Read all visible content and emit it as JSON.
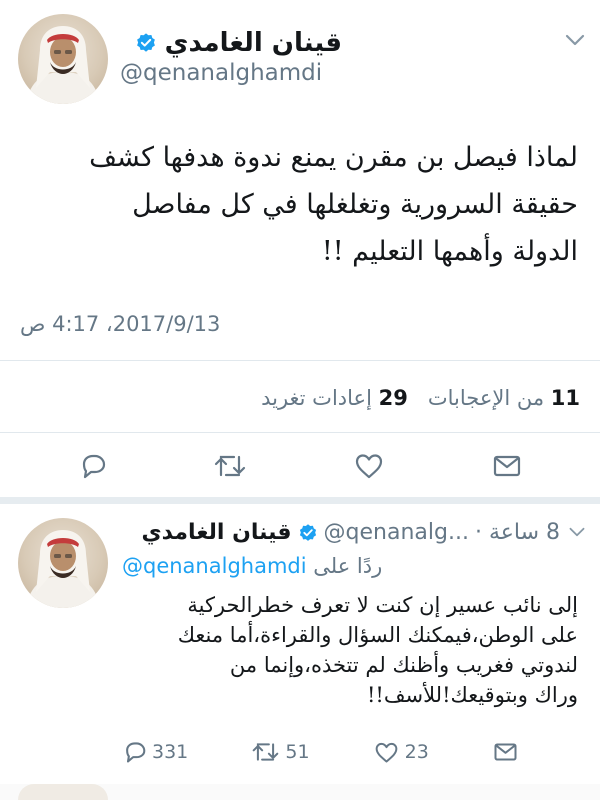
{
  "main_tweet": {
    "display_name": "قينان الغامدي",
    "handle": "@qenanalghamdi",
    "text_lines": [
      "لماذا فيصل بن مقرن يمنع ندوة هدفها كشف",
      "حقيقة السرورية وتغلغلها في كل مفاصل",
      "الدولة وأهمها التعليم !!"
    ],
    "timestamp": "2017/9/13، 4:17 ص",
    "likes_count": "11",
    "likes_label": "من الإعجابات",
    "retweets_count": "29",
    "retweets_label": "إعادات تغريد"
  },
  "reply_tweet": {
    "display_name": "قينان الغامدي",
    "handle": "@qenanalg...",
    "time_ago": "8 ساعة ·",
    "replying_to_label": "ردًا على",
    "replying_to_handle": "@qenanalghamdi",
    "text_lines": [
      "إلى نائب عسير إن كنت لا تعرف خطرالحركية",
      "على الوطن،فيمكنك السؤال والقراءة،أما منعك",
      "لندوتي فغريب وأظنك لم تتخذه،وإنما من",
      "وراك وبتوقيعك!للأسف!!"
    ],
    "reply_count": "331",
    "retweet_count": "51",
    "like_count": "23"
  },
  "colors": {
    "accent_blue": "#1da1f2",
    "muted_gray": "#657786",
    "text_dark": "#14171a",
    "divider": "#e1e8ed"
  },
  "icons": [
    "chevron-down-icon",
    "verified-badge-icon",
    "reply-icon",
    "retweet-icon",
    "like-icon",
    "dm-icon"
  ]
}
